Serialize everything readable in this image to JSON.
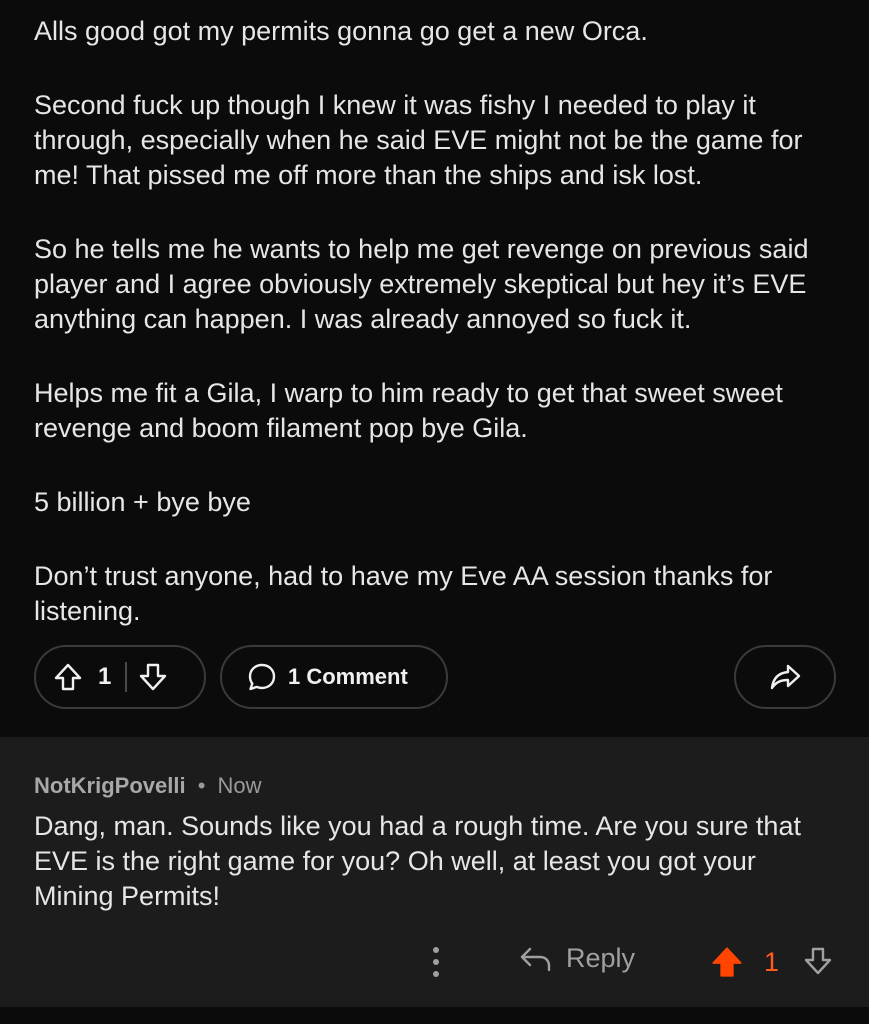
{
  "post": {
    "paragraphs": [
      "Alls good got my permits gonna go get a new Orca.",
      "Second fuck up though I knew it was fishy I needed to play it through, especially when he said EVE might not be the game for me! That pissed me off more than the ships and isk lost.",
      "So he tells me he wants to help me get revenge on previous said player and I agree obviously extremely skeptical but hey it’s EVE anything can happen. I was already annoyed so fuck it.",
      "Helps me fit a Gila, I warp to him ready to get that sweet sweet revenge and boom filament pop bye Gila.",
      "5 billion + bye bye",
      "Don’t trust anyone, had to have my Eve AA session thanks for listening."
    ],
    "vote_count": "1",
    "comment_label": "1 Comment"
  },
  "comment": {
    "author": "NotKrigPovelli",
    "separator": "•",
    "time": "Now",
    "body": "Dang, man.  Sounds like you had a rough time.  Are you sure that EVE is the right game for you?   Oh well, at least you got your Mining Permits!",
    "reply_label": "Reply",
    "vote_count": "1"
  },
  "icons": {
    "upvote": "upvote-arrow-icon",
    "downvote": "downvote-arrow-icon",
    "comment": "speech-bubble-icon",
    "share": "share-arrow-icon",
    "more": "vertical-dots-icon",
    "reply": "reply-arrow-icon"
  },
  "colors": {
    "background": "#0b0b0b",
    "comment_background": "#1c1c1c",
    "upvote_active": "#ff4500"
  }
}
